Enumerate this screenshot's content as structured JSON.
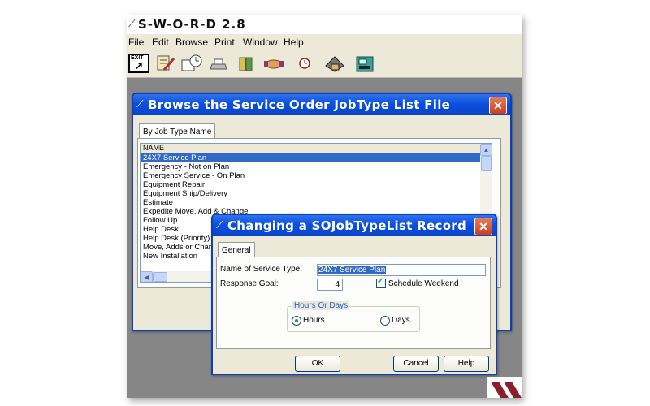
{
  "app": {
    "title": "S-W-O-R-D 2.8"
  },
  "menu": [
    "File",
    "Edit",
    "Browse",
    "Print",
    "Window",
    "Help"
  ],
  "toolbar": {
    "exit_label": "EXIT",
    "icons": [
      "edit-record-icon",
      "schedule-icon",
      "print-icon",
      "books-icon",
      "handshake-icon",
      "clock-icon",
      "tools-icon",
      "workstation-icon"
    ]
  },
  "browse": {
    "title": "Browse the Service Order JobType List File",
    "tab": "By Job Type Name",
    "column": "NAME",
    "rows": [
      "24X7 Service Plan",
      "Emergency - Not on Plan",
      "Emergency Service - On Plan",
      "Equipment Repair",
      "Equipment Ship/Delivery",
      "Estimate",
      "Expedite Move, Add & Change",
      "Follow Up",
      "Help Desk",
      "Help Desk (Priority)",
      "Move, Adds or Char",
      "New Installation"
    ],
    "selected_index": 0
  },
  "dialog": {
    "title": "Changing a SOJobTypeList Record",
    "tab": "General",
    "name_label": "Name of Service Type:",
    "name_value": "24X7 Service Plan",
    "goal_label": "Response Goal:",
    "goal_value": "4",
    "weekend_label": "Schedule Weekend",
    "weekend_checked": true,
    "group_label": "Hours Or Days",
    "hours_label": "Hours",
    "days_label": "Days",
    "selected_unit": "Hours",
    "ok_label": "OK",
    "cancel_label": "Cancel",
    "help_label": "Help"
  },
  "colors": {
    "titlebar": "#0a4fdc",
    "selection": "#316ac5",
    "desktop": "#868686"
  }
}
